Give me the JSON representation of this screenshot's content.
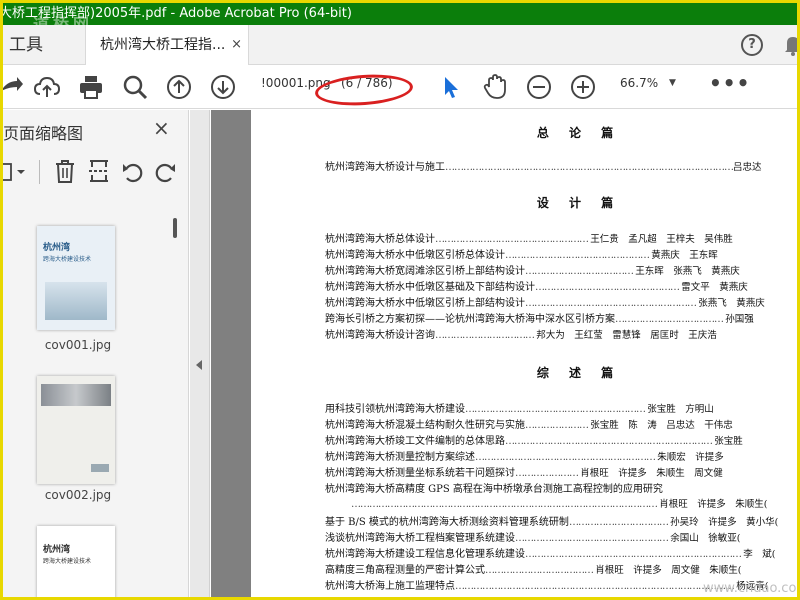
{
  "window": {
    "title": "大桥工程指挥部)2005年.pdf - Adobe Acrobat Pro (64-bit)",
    "watermark_top": "道桥网",
    "watermark_bottom": "www.cndao.com"
  },
  "tabs": {
    "tools_label": "工具",
    "doc_label": "杭州湾大桥工程指...",
    "close_glyph": "×"
  },
  "toolbar": {
    "filename": "!00001.png",
    "page_indicator": "(6 / 786)",
    "zoom": "66.7%",
    "more": "•••"
  },
  "left_panel": {
    "title": "页面缩略图",
    "close_glyph": "×",
    "thumbnails": [
      {
        "label": "cov001.jpg",
        "cover_title": "杭州湾",
        "cover_sub": "跨海大桥建设技术"
      },
      {
        "label": "cov002.jpg"
      },
      {
        "label": "",
        "cover_title": "杭州湾",
        "cover_sub": "跨海大桥建设技术"
      }
    ]
  },
  "document": {
    "sections": [
      {
        "heading": "总 论 篇",
        "entries": [
          {
            "title": "杭州湾跨海大桥设计与施工",
            "authors": "吕忠达"
          }
        ]
      },
      {
        "heading": "设 计 篇",
        "entries": [
          {
            "title": "杭州湾跨海大桥总体设计",
            "authors": "王仁贵　孟凡超　王梓夫　吴伟胜"
          },
          {
            "title": "杭州湾跨海大桥水中低墩区引桥总体设计",
            "authors": "黄燕庆　王东晖"
          },
          {
            "title": "杭州湾跨海大桥宽阔滩涂区引桥上部结构设计",
            "authors": "王东晖　张燕飞　黄燕庆"
          },
          {
            "title": "杭州湾跨海大桥水中低墩区基础及下部结构设计",
            "authors": "雷文平　黄燕庆"
          },
          {
            "title": "杭州湾跨海大桥水中低墩区引桥上部结构设计",
            "authors": "张燕飞　黄燕庆"
          },
          {
            "title": "跨海长引桥之方案初探——论杭州湾跨海大桥海中深水区引桥方案",
            "authors": "孙国强"
          },
          {
            "title": "杭州湾跨海大桥设计咨询",
            "authors": "邦大为　王红莹　雷慧锋　居匡时　王庆浩"
          }
        ]
      },
      {
        "heading": "综 述 篇",
        "entries": [
          {
            "title": "用科技引领杭州湾跨海大桥建设",
            "authors": "张宝胜　方明山"
          },
          {
            "title": "杭州湾跨海大桥混凝土结构耐久性研究与实施",
            "authors": "张宝胜　陈　涛　吕忠达　干伟忠"
          },
          {
            "title": "杭州湾跨海大桥竣工文件编制的总体思路",
            "authors": "张宝胜"
          },
          {
            "title": "杭州湾跨海大桥测量控制方案综述",
            "authors": "朱顺宏　许提多"
          },
          {
            "title": "杭州湾跨海大桥测量坐标系统若干问题探讨",
            "authors": "肖根旺　许提多　朱顺生　周文健"
          },
          {
            "title": "杭州湾跨海大桥高精度 GPS 高程在海中桥墩承台测施工高程控制的应用研究",
            "authors": ""
          },
          {
            "title": "",
            "authors": "肖根旺　许提多　朱顺生(　"
          },
          {
            "title": "基于 B/S 模式的杭州湾跨海大桥测绘资料管理系统研制",
            "authors": "孙吴玲　许提多　黄小华(　"
          },
          {
            "title": "浅谈杭州湾跨海大桥工程档案管理系统建设",
            "authors": "余国山　徐敏亚(　"
          },
          {
            "title": "杭州湾跨海大桥建设工程信息化管理系统建设",
            "authors": "李　斌("
          },
          {
            "title": "高精度三角高程测量的严密计算公式",
            "authors": "肖根旺　许提多　周文健　朱顺生("
          },
          {
            "title": "杭州湾大桥海上施工监理特点",
            "authors": "杨远青("
          }
        ]
      }
    ]
  },
  "colors": {
    "title_bar": "#0b7e0b",
    "frame": "#e8d800",
    "annotation": "#d92020",
    "select_arrow": "#1a6fd9"
  }
}
